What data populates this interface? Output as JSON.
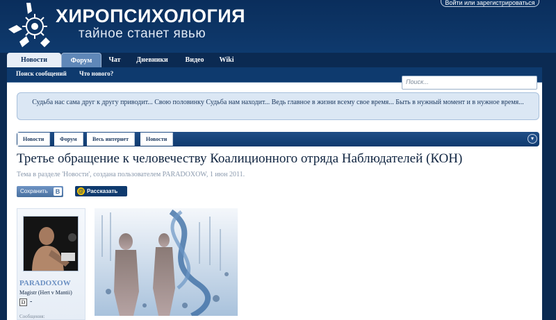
{
  "header": {
    "site_title": "ХИРОПСИХОЛОГИЯ",
    "site_tagline": "тайное станет явью",
    "login_label": "Войти или зарегистрироваться"
  },
  "nav": {
    "tabs": [
      {
        "label": "Новости",
        "active": false
      },
      {
        "label": "Форум",
        "active": true
      },
      {
        "label": "Чат",
        "active": false
      },
      {
        "label": "Дневники",
        "active": false
      },
      {
        "label": "Видео",
        "active": false
      },
      {
        "label": "Wiki",
        "active": false
      }
    ],
    "sublinks": [
      "Поиск сообщений",
      "Что нового?"
    ]
  },
  "search": {
    "placeholder": "Поиск..."
  },
  "notice": "Судьба нас сама друг к другу приводит... Свою половинку Судьба нам находит... Ведь главное в жизни всему свое время... Быть в нужный момент и в нужное время...",
  "breadcrumb": [
    "Новости",
    "Форум",
    "Весь интернет",
    "Новости"
  ],
  "thread": {
    "title": "Третье обращение к человечеству Коалиционного отряда Наблюдателей (КОН)",
    "meta": "Тема в разделе 'Новости', создана пользователем PARADOXOW, 1 июн 2011."
  },
  "share": {
    "save_label": "Сохранить",
    "save_badge": "В",
    "tell_label": "Рассказать"
  },
  "author": {
    "name": "PARADOXOW",
    "title": "Magistr (Hert v Mantii)",
    "badge": "Ð",
    "dash": "-",
    "messages_label": "Сообщения:"
  },
  "colors": {
    "header_bg": "#0a2e5c",
    "accent": "#0e3a6e",
    "link": "#6a8fc2",
    "notice_bg": "#dbe7f4"
  }
}
